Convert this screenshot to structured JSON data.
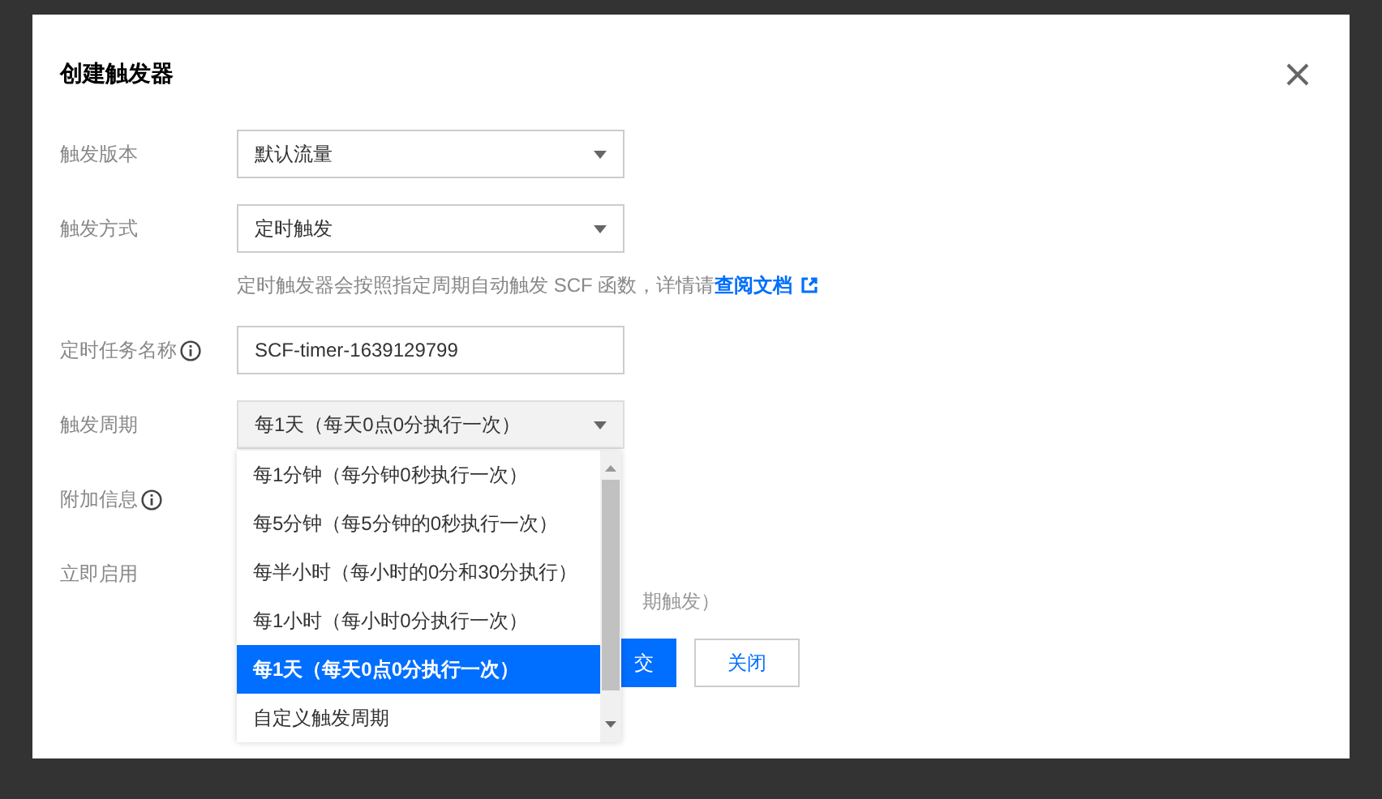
{
  "dialog": {
    "title": "创建触发器",
    "fields": [
      {
        "label": "触发版本",
        "kind": "select",
        "value": "默认流量",
        "info": false,
        "expanded": false
      },
      {
        "label": "触发方式",
        "kind": "select",
        "value": "定时触发",
        "info": false,
        "expanded": false,
        "help": {
          "text": "定时触发器会按照指定周期自动触发 SCF 函数，详情请",
          "link": "查阅文档"
        }
      },
      {
        "label": "定时任务名称",
        "kind": "input",
        "value": "SCF-timer-1639129799",
        "info": true
      },
      {
        "label": "触发周期",
        "kind": "select",
        "value": "每1天（每天0点0分执行一次）",
        "info": false,
        "expanded": true
      },
      {
        "label": "附加信息",
        "kind": "covered",
        "info": true
      },
      {
        "label": "立即启用",
        "kind": "covered",
        "info": false,
        "note": "期触发）"
      }
    ],
    "buttons": [
      {
        "label": "交",
        "kind": "primary"
      },
      {
        "label": "关闭",
        "kind": "secondary"
      }
    ],
    "dropdown": {
      "options": [
        {
          "label": "每1分钟（每分钟0秒执行一次）",
          "selected": false
        },
        {
          "label": "每5分钟（每5分钟的0秒执行一次）",
          "selected": false
        },
        {
          "label": "每半小时（每小时的0分和30分执行）",
          "selected": false
        },
        {
          "label": "每1小时（每小时0分执行一次）",
          "selected": false
        },
        {
          "label": "每1天（每天0点0分执行一次）",
          "selected": true
        },
        {
          "label": "自定义触发周期",
          "selected": false
        }
      ]
    }
  }
}
